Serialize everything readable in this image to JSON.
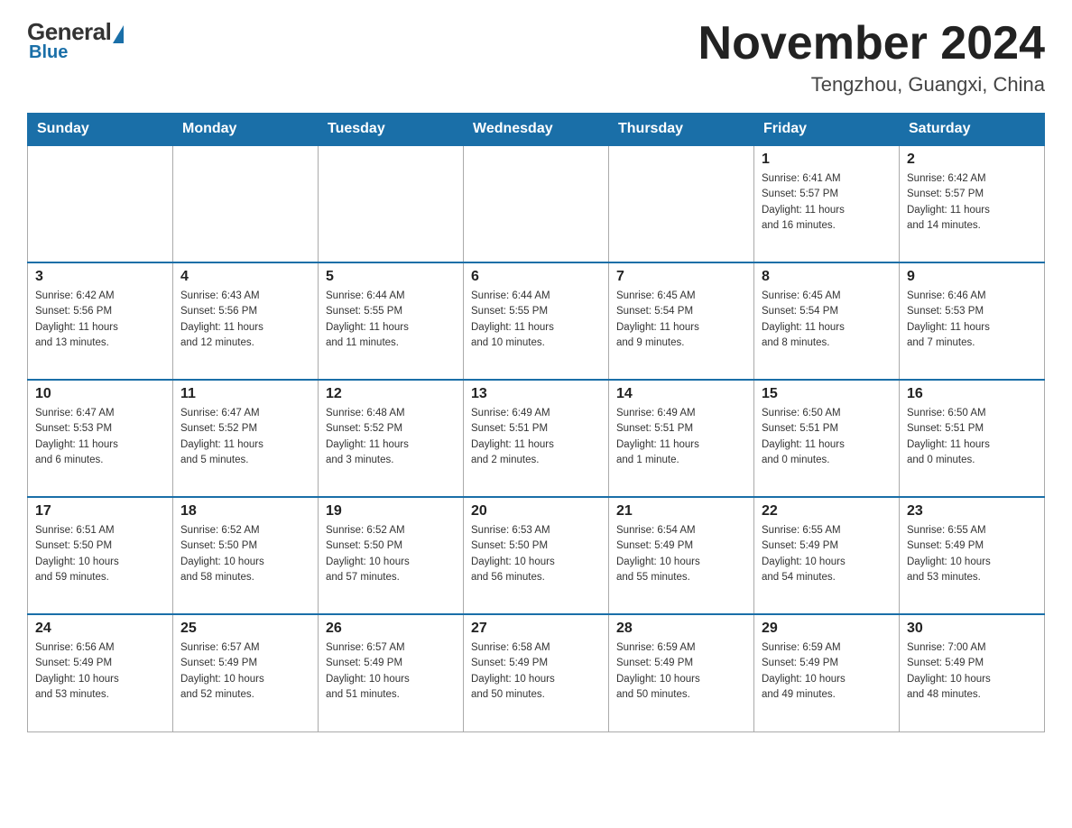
{
  "header": {
    "logo": {
      "general": "General",
      "blue": "Blue"
    },
    "title": "November 2024",
    "location": "Tengzhou, Guangxi, China"
  },
  "weekdays": [
    "Sunday",
    "Monday",
    "Tuesday",
    "Wednesday",
    "Thursday",
    "Friday",
    "Saturday"
  ],
  "weeks": [
    [
      {
        "day": "",
        "info": ""
      },
      {
        "day": "",
        "info": ""
      },
      {
        "day": "",
        "info": ""
      },
      {
        "day": "",
        "info": ""
      },
      {
        "day": "",
        "info": ""
      },
      {
        "day": "1",
        "info": "Sunrise: 6:41 AM\nSunset: 5:57 PM\nDaylight: 11 hours\nand 16 minutes."
      },
      {
        "day": "2",
        "info": "Sunrise: 6:42 AM\nSunset: 5:57 PM\nDaylight: 11 hours\nand 14 minutes."
      }
    ],
    [
      {
        "day": "3",
        "info": "Sunrise: 6:42 AM\nSunset: 5:56 PM\nDaylight: 11 hours\nand 13 minutes."
      },
      {
        "day": "4",
        "info": "Sunrise: 6:43 AM\nSunset: 5:56 PM\nDaylight: 11 hours\nand 12 minutes."
      },
      {
        "day": "5",
        "info": "Sunrise: 6:44 AM\nSunset: 5:55 PM\nDaylight: 11 hours\nand 11 minutes."
      },
      {
        "day": "6",
        "info": "Sunrise: 6:44 AM\nSunset: 5:55 PM\nDaylight: 11 hours\nand 10 minutes."
      },
      {
        "day": "7",
        "info": "Sunrise: 6:45 AM\nSunset: 5:54 PM\nDaylight: 11 hours\nand 9 minutes."
      },
      {
        "day": "8",
        "info": "Sunrise: 6:45 AM\nSunset: 5:54 PM\nDaylight: 11 hours\nand 8 minutes."
      },
      {
        "day": "9",
        "info": "Sunrise: 6:46 AM\nSunset: 5:53 PM\nDaylight: 11 hours\nand 7 minutes."
      }
    ],
    [
      {
        "day": "10",
        "info": "Sunrise: 6:47 AM\nSunset: 5:53 PM\nDaylight: 11 hours\nand 6 minutes."
      },
      {
        "day": "11",
        "info": "Sunrise: 6:47 AM\nSunset: 5:52 PM\nDaylight: 11 hours\nand 5 minutes."
      },
      {
        "day": "12",
        "info": "Sunrise: 6:48 AM\nSunset: 5:52 PM\nDaylight: 11 hours\nand 3 minutes."
      },
      {
        "day": "13",
        "info": "Sunrise: 6:49 AM\nSunset: 5:51 PM\nDaylight: 11 hours\nand 2 minutes."
      },
      {
        "day": "14",
        "info": "Sunrise: 6:49 AM\nSunset: 5:51 PM\nDaylight: 11 hours\nand 1 minute."
      },
      {
        "day": "15",
        "info": "Sunrise: 6:50 AM\nSunset: 5:51 PM\nDaylight: 11 hours\nand 0 minutes."
      },
      {
        "day": "16",
        "info": "Sunrise: 6:50 AM\nSunset: 5:51 PM\nDaylight: 11 hours\nand 0 minutes."
      }
    ],
    [
      {
        "day": "17",
        "info": "Sunrise: 6:51 AM\nSunset: 5:50 PM\nDaylight: 10 hours\nand 59 minutes."
      },
      {
        "day": "18",
        "info": "Sunrise: 6:52 AM\nSunset: 5:50 PM\nDaylight: 10 hours\nand 58 minutes."
      },
      {
        "day": "19",
        "info": "Sunrise: 6:52 AM\nSunset: 5:50 PM\nDaylight: 10 hours\nand 57 minutes."
      },
      {
        "day": "20",
        "info": "Sunrise: 6:53 AM\nSunset: 5:50 PM\nDaylight: 10 hours\nand 56 minutes."
      },
      {
        "day": "21",
        "info": "Sunrise: 6:54 AM\nSunset: 5:49 PM\nDaylight: 10 hours\nand 55 minutes."
      },
      {
        "day": "22",
        "info": "Sunrise: 6:55 AM\nSunset: 5:49 PM\nDaylight: 10 hours\nand 54 minutes."
      },
      {
        "day": "23",
        "info": "Sunrise: 6:55 AM\nSunset: 5:49 PM\nDaylight: 10 hours\nand 53 minutes."
      }
    ],
    [
      {
        "day": "24",
        "info": "Sunrise: 6:56 AM\nSunset: 5:49 PM\nDaylight: 10 hours\nand 53 minutes."
      },
      {
        "day": "25",
        "info": "Sunrise: 6:57 AM\nSunset: 5:49 PM\nDaylight: 10 hours\nand 52 minutes."
      },
      {
        "day": "26",
        "info": "Sunrise: 6:57 AM\nSunset: 5:49 PM\nDaylight: 10 hours\nand 51 minutes."
      },
      {
        "day": "27",
        "info": "Sunrise: 6:58 AM\nSunset: 5:49 PM\nDaylight: 10 hours\nand 50 minutes."
      },
      {
        "day": "28",
        "info": "Sunrise: 6:59 AM\nSunset: 5:49 PM\nDaylight: 10 hours\nand 50 minutes."
      },
      {
        "day": "29",
        "info": "Sunrise: 6:59 AM\nSunset: 5:49 PM\nDaylight: 10 hours\nand 49 minutes."
      },
      {
        "day": "30",
        "info": "Sunrise: 7:00 AM\nSunset: 5:49 PM\nDaylight: 10 hours\nand 48 minutes."
      }
    ]
  ]
}
